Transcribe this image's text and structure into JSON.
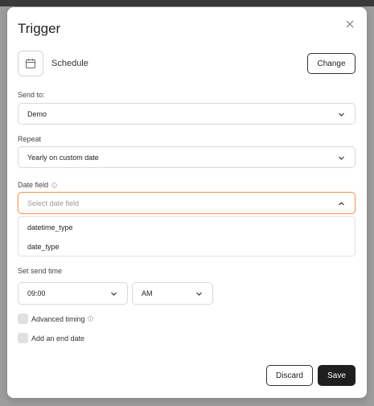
{
  "modal": {
    "title": "Trigger",
    "trigger_type": {
      "label": "Schedule",
      "change_label": "Change",
      "icon": "calendar-icon"
    },
    "send_to": {
      "label": "Send to:",
      "value": "Demo"
    },
    "repeat": {
      "label": "Repeat",
      "value": "Yearly on custom date"
    },
    "date_field": {
      "label": "Date field",
      "placeholder": "Select date field",
      "options": [
        "datetime_type",
        "date_type"
      ]
    },
    "send_time": {
      "label": "Set send time",
      "time": "09:00",
      "period": "AM"
    },
    "checkboxes": {
      "advanced_timing": "Advanced timing",
      "end_date": "Add an end date"
    },
    "buttons": {
      "discard": "Discard",
      "save": "Save"
    }
  },
  "colors": {
    "focus_border": "#f0a36b",
    "primary_button": "#1f1f1f"
  }
}
